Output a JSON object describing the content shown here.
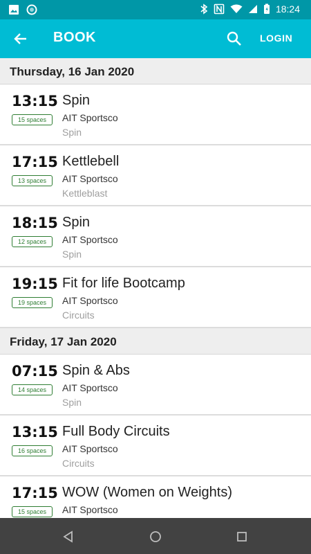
{
  "status": {
    "time": "18:24"
  },
  "appbar": {
    "title": "BOOK",
    "login_label": "LOGIN"
  },
  "days": [
    {
      "header": "Thursday, 16 Jan 2020",
      "sessions": [
        {
          "time": "13:15",
          "spaces": "15 spaces",
          "name": "Spin",
          "venue": "AIT Sportsco",
          "category": "Spin"
        },
        {
          "time": "17:15",
          "spaces": "13 spaces",
          "name": "Kettlebell",
          "venue": "AIT Sportsco",
          "category": "Kettleblast"
        },
        {
          "time": "18:15",
          "spaces": "12 spaces",
          "name": "Spin",
          "venue": "AIT Sportsco",
          "category": "Spin"
        },
        {
          "time": "19:15",
          "spaces": "19 spaces",
          "name": "Fit for life Bootcamp",
          "venue": "AIT Sportsco",
          "category": "Circuits"
        }
      ]
    },
    {
      "header": "Friday, 17 Jan 2020",
      "sessions": [
        {
          "time": "07:15",
          "spaces": "14 spaces",
          "name": "Spin & Abs",
          "venue": "AIT Sportsco",
          "category": "Spin"
        },
        {
          "time": "13:15",
          "spaces": "16 spaces",
          "name": "Full Body Circuits",
          "venue": "AIT Sportsco",
          "category": "Circuits"
        },
        {
          "time": "17:15",
          "spaces": "15 spaces",
          "name": "WOW (Women on Weights)",
          "venue": "AIT Sportsco",
          "category": ""
        }
      ]
    }
  ],
  "colors": {
    "appbar": "#00bcd4",
    "statusbar": "#0097a7",
    "spaces_badge": "#2e7d32"
  }
}
